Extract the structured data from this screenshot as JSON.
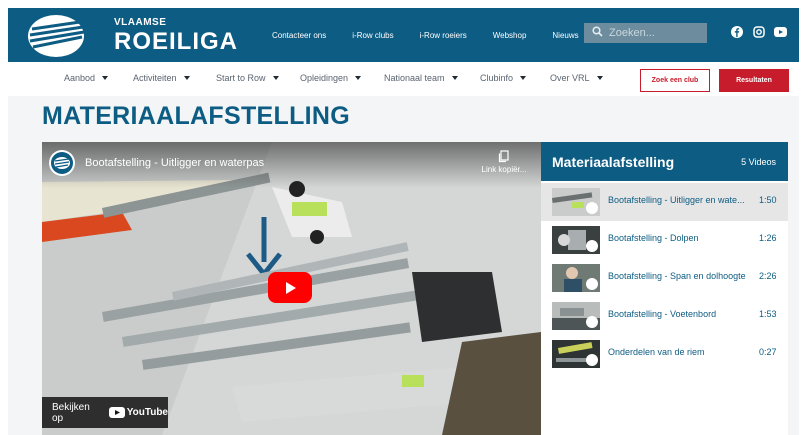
{
  "brand": {
    "small": "VLAAMSE",
    "big": "ROEILIGA"
  },
  "topnav": [
    "Contacteer ons",
    "i-Row clubs",
    "i-Row roeiers",
    "Webshop",
    "Nieuws"
  ],
  "search": {
    "placeholder": "Zoeken..."
  },
  "social": [
    "facebook-icon",
    "instagram-icon",
    "youtube-icon"
  ],
  "subnav": {
    "items": [
      "Aanbod",
      "Activiteiten",
      "Start to Row",
      "Opleidingen",
      "Nationaal team",
      "Clubinfo",
      "Over VRL"
    ],
    "find_club": "Zoek een club",
    "results": "Resultaten"
  },
  "page_title": "MATERIAALAFSTELLING",
  "video": {
    "title": "Bootafstelling - Uitligger en waterpas",
    "copy_link": "Link kopiër...",
    "watch_on": "Bekijken op",
    "platform": "YouTube"
  },
  "playlist": {
    "title": "Materiaalafstelling",
    "count": "5 Videos",
    "items": [
      {
        "label": "Bootafstelling - Uitligger en wate...",
        "duration": "1:50"
      },
      {
        "label": "Bootafstelling - Dolpen",
        "duration": "1:26"
      },
      {
        "label": "Bootafstelling - Span en dolhoogte",
        "duration": "2:26"
      },
      {
        "label": "Bootafstelling - Voetenbord",
        "duration": "1:53"
      },
      {
        "label": "Onderdelen van de riem",
        "duration": "0:27"
      }
    ]
  },
  "colors": {
    "brand_blue": "#0d5c83",
    "accent_red": "#c61c2b"
  }
}
